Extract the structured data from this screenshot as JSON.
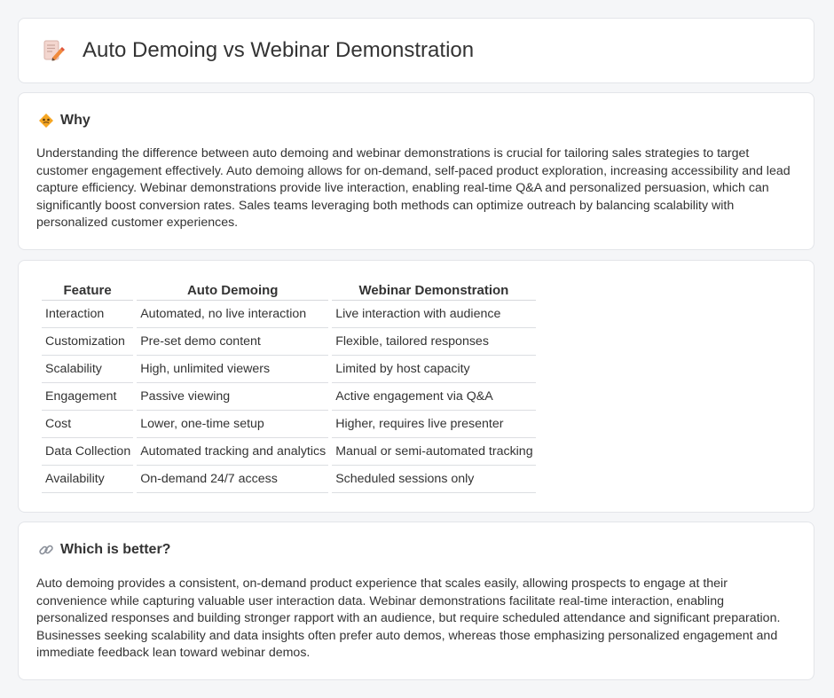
{
  "header": {
    "title": "Auto Demoing vs Webinar Demonstration",
    "icon": "document-pencil-icon"
  },
  "why": {
    "icon": "diamond-warning-icon",
    "title": "Why",
    "text": "Understanding the difference between auto demoing and webinar demonstrations is crucial for tailoring sales strategies to target customer engagement effectively. Auto demoing allows for on-demand, self-paced product exploration, increasing accessibility and lead capture efficiency. Webinar demonstrations provide live interaction, enabling real-time Q&A and personalized persuasion, which can significantly boost conversion rates. Sales teams leveraging both methods can optimize outreach by balancing scalability with personalized customer experiences."
  },
  "table": {
    "headers": [
      "Feature",
      "Auto Demoing",
      "Webinar Demonstration"
    ],
    "rows": [
      [
        "Interaction",
        "Automated, no live interaction",
        "Live interaction with audience"
      ],
      [
        "Customization",
        "Pre-set demo content",
        "Flexible, tailored responses"
      ],
      [
        "Scalability",
        "High, unlimited viewers",
        "Limited by host capacity"
      ],
      [
        "Engagement",
        "Passive viewing",
        "Active engagement via Q&A"
      ],
      [
        "Cost",
        "Lower, one-time setup",
        "Higher, requires live presenter"
      ],
      [
        "Data Collection",
        "Automated tracking and analytics",
        "Manual or semi-automated tracking"
      ],
      [
        "Availability",
        "On-demand 24/7 access",
        "Scheduled sessions only"
      ]
    ]
  },
  "better": {
    "icon": "link-icon",
    "title": "Which is better?",
    "text": "Auto demoing provides a consistent, on-demand product experience that scales easily, allowing prospects to engage at their convenience while capturing valuable user interaction data. Webinar demonstrations facilitate real-time interaction, enabling personalized responses and building stronger rapport with an audience, but require scheduled attendance and significant preparation. Businesses seeking scalability and data insights often prefer auto demos, whereas those emphasizing personalized engagement and immediate feedback lean toward webinar demos."
  },
  "colors": {
    "background": "#f5f6f8",
    "card": "#ffffff",
    "border": "#e3e5e9",
    "text": "#333333"
  }
}
